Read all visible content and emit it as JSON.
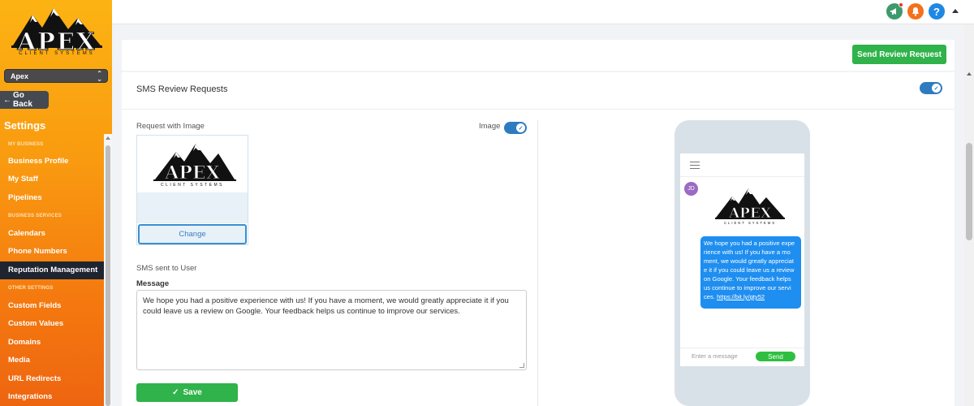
{
  "sidebar": {
    "logo_text": "APEX",
    "logo_sub": "CLIENT SYSTEMS",
    "location": "Apex",
    "go_back": "Go Back",
    "settings_title": "Settings",
    "sections": {
      "my_business": "MY BUSINESS",
      "business_services": "BUSINESS SERVICES",
      "other_settings": "OTHER SETTINGS"
    },
    "items": [
      {
        "label": "Business Profile"
      },
      {
        "label": "My Staff"
      },
      {
        "label": "Pipelines"
      },
      {
        "label": "Calendars"
      },
      {
        "label": "Phone Numbers"
      },
      {
        "label": "Reputation Management",
        "active": true
      },
      {
        "label": "Custom Fields"
      },
      {
        "label": "Custom Values"
      },
      {
        "label": "Domains"
      },
      {
        "label": "Media"
      },
      {
        "label": "URL Redirects"
      },
      {
        "label": "Integrations"
      }
    ]
  },
  "topbar": {
    "icons": [
      {
        "name": "megaphone-icon",
        "color": "#3c9a6b"
      },
      {
        "name": "bell-icon",
        "color": "#f5701a"
      },
      {
        "name": "help-icon",
        "color": "#1e88e5",
        "glyph": "?"
      }
    ]
  },
  "header": {
    "send_review_request": "Send Review Request"
  },
  "sms_card": {
    "title": "SMS Review Requests",
    "enabled": true,
    "request_with_image": "Request with Image",
    "image_label": "Image",
    "image_enabled": true,
    "change_label": "Change",
    "sms_sent_label": "SMS sent to User",
    "message_label": "Message",
    "message_value": "We hope you had a positive experience with us! If you have a moment, we would greatly appreciate it if you could leave us a review on Google. Your feedback helps us continue to improve our services.",
    "save_label": "Save"
  },
  "preview": {
    "avatar_initials": "JD",
    "bubble_lines": [
      "We hope you had a positive expe",
      "rience with us! If you have a mo",
      "ment, we would greatly appreciat",
      "e it if you could leave us a review",
      "on Google. Your feedback helps",
      "us continue to improve our servi",
      "ces."
    ],
    "link": "https://bit.ly/gty52",
    "compose_placeholder": "Enter a message",
    "send_label": "Send"
  },
  "colors": {
    "accent_green": "#2fb34a",
    "toggle_blue": "#2e7bbf",
    "bubble_blue": "#1e8ef0",
    "sidebar_orange": "#f99a10",
    "active_nav": "#1f2530"
  }
}
